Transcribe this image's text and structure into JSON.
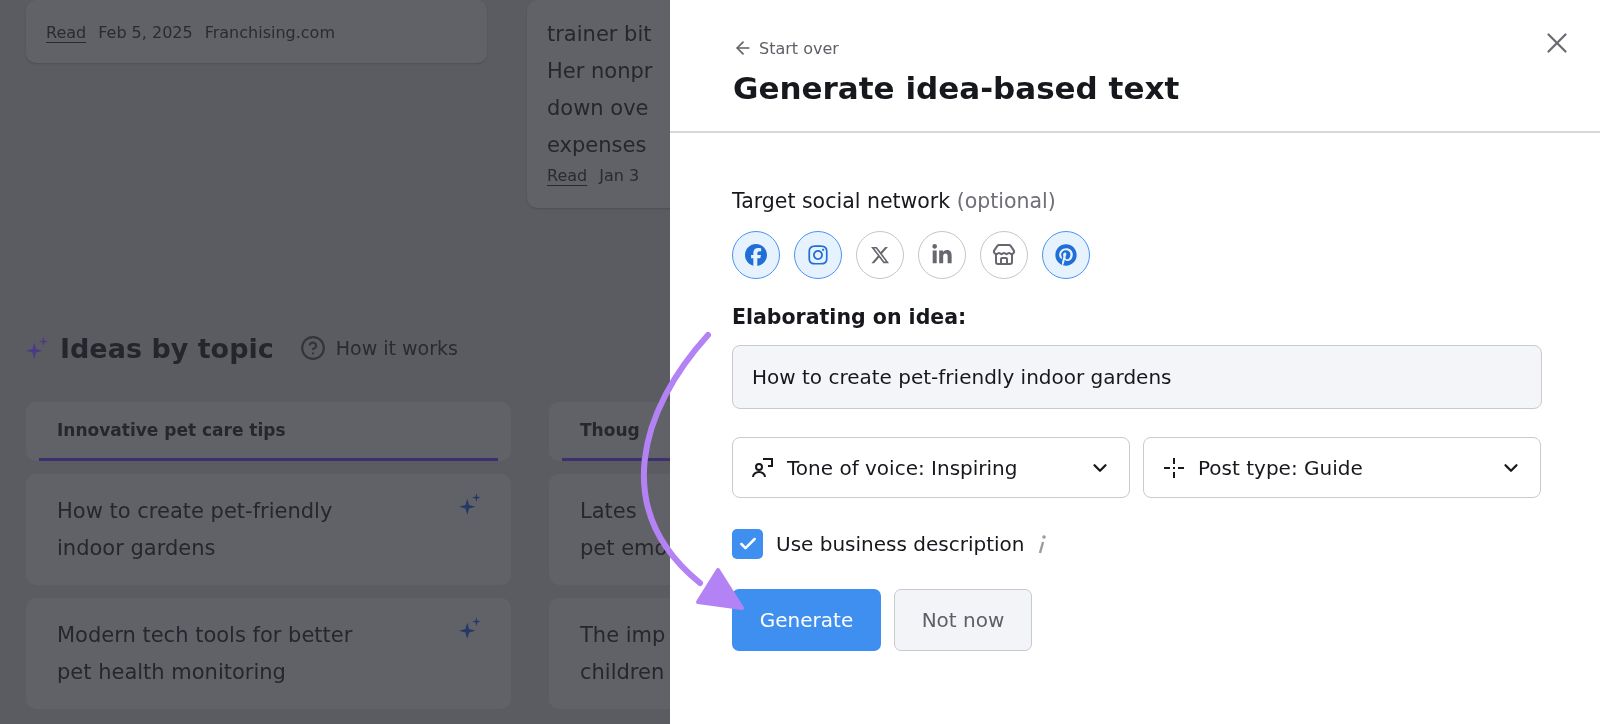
{
  "background": {
    "articles": [
      {
        "link": "Read",
        "date": "Feb 5, 2025",
        "source": "Franchising.com"
      },
      {
        "title_lines": [
          "trainer bit",
          "Her nonpr",
          "down ove",
          "expenses"
        ],
        "link": "Read",
        "date": "Jan 3"
      }
    ],
    "section": {
      "title": "Ideas by topic",
      "help_link": "How it works"
    },
    "topics": [
      {
        "title": "Innovative pet care tips",
        "ideas": [
          {
            "lines": [
              "How to create pet-friendly",
              "indoor gardens"
            ]
          },
          {
            "lines": [
              "Modern tech tools for better",
              "pet health monitoring"
            ]
          }
        ]
      },
      {
        "title": "Thoug",
        "ideas": [
          {
            "lines": [
              "Lates",
              "pet emo"
            ]
          },
          {
            "lines": [
              "The imp",
              "children"
            ]
          }
        ]
      }
    ]
  },
  "panel": {
    "back_link": "Start over",
    "title": "Generate idea-based text",
    "network_label": "Target social network",
    "network_hint": "(optional)",
    "networks": [
      {
        "kind": "facebook",
        "selected": true
      },
      {
        "kind": "instagram",
        "selected": true
      },
      {
        "kind": "x",
        "selected": false
      },
      {
        "kind": "linkedin",
        "selected": false
      },
      {
        "kind": "business",
        "selected": false
      },
      {
        "kind": "pinterest",
        "selected": true
      }
    ],
    "idea_label": "Elaborating on idea:",
    "idea_value": "How to create pet-friendly indoor gardens",
    "selects": [
      {
        "kind": "tone",
        "value": "Tone of voice: Inspiring"
      },
      {
        "kind": "post_type",
        "value": "Post type: Guide"
      }
    ],
    "use_business": {
      "label": "Use business description",
      "checked": true
    },
    "buttons": [
      {
        "kind": "primary",
        "label": "Generate"
      },
      {
        "kind": "secondary",
        "label": "Not now"
      }
    ]
  }
}
